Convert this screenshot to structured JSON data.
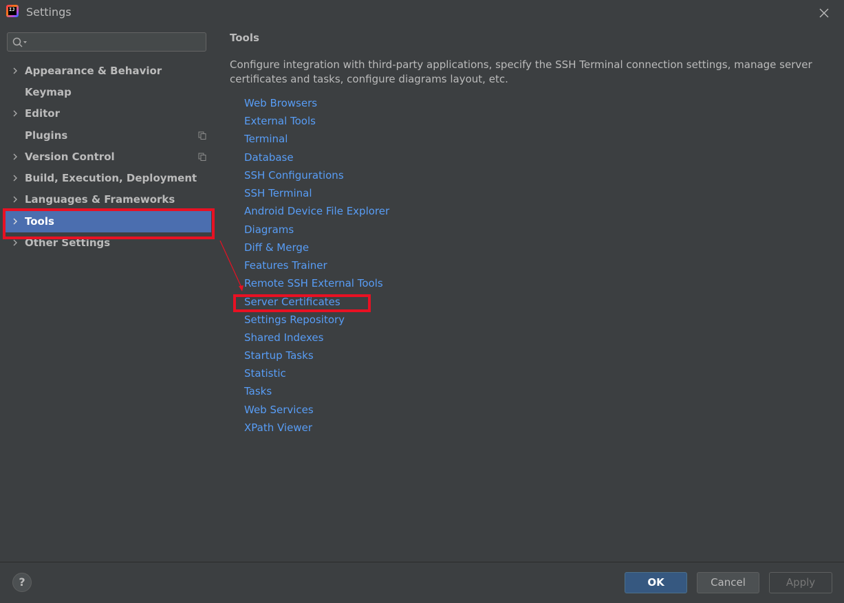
{
  "window": {
    "title": "Settings",
    "app_icon_text": "IJ"
  },
  "search": {
    "value": "",
    "placeholder": ""
  },
  "sidebar": {
    "items": [
      {
        "label": "Appearance & Behavior",
        "expandable": true
      },
      {
        "label": "Keymap",
        "expandable": false
      },
      {
        "label": "Editor",
        "expandable": true
      },
      {
        "label": "Plugins",
        "expandable": false
      },
      {
        "label": "Version Control",
        "expandable": true
      },
      {
        "label": "Build, Execution, Deployment",
        "expandable": true
      },
      {
        "label": "Languages & Frameworks",
        "expandable": true
      },
      {
        "label": "Tools",
        "expandable": true,
        "selected": true
      },
      {
        "label": "Other Settings",
        "expandable": true
      }
    ]
  },
  "main": {
    "title": "Tools",
    "description": "Configure integration with third-party applications, specify the SSH Terminal connection settings, manage server certificates and tasks, configure diagrams layout, etc.",
    "links": [
      "Web Browsers",
      "External Tools",
      "Terminal",
      "Database",
      "SSH Configurations",
      "SSH Terminal",
      "Android Device File Explorer",
      "Diagrams",
      "Diff & Merge",
      "Features Trainer",
      "Remote SSH External Tools",
      "Server Certificates",
      "Settings Repository",
      "Shared Indexes",
      "Startup Tasks",
      "Statistic",
      "Tasks",
      "Web Services",
      "XPath Viewer"
    ]
  },
  "buttons": {
    "help": "?",
    "ok": "OK",
    "cancel": "Cancel",
    "apply": "Apply"
  },
  "colors": {
    "background": "#3c3f41",
    "selection": "#4b6eaf",
    "link": "#589df6",
    "annotation": "#e81123",
    "ok_button": "#365880"
  }
}
